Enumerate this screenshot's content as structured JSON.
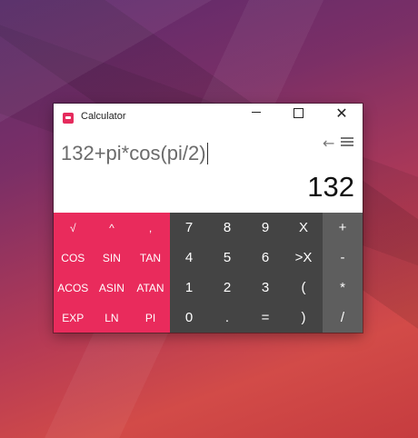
{
  "window": {
    "title": "Calculator"
  },
  "window_controls": {
    "minimize": "",
    "maximize": "",
    "close": "✕"
  },
  "display": {
    "expression": "132+pi*cos(pi/2)",
    "result": "132"
  },
  "function_keys": [
    [
      "√",
      "^",
      ","
    ],
    [
      "COS",
      "SIN",
      "TAN"
    ],
    [
      "ACOS",
      "ASIN",
      "ATAN"
    ],
    [
      "EXP",
      "LN",
      "PI"
    ]
  ],
  "number_keys": [
    [
      "7",
      "8",
      "9",
      "X"
    ],
    [
      "4",
      "5",
      "6",
      ">X"
    ],
    [
      "1",
      "2",
      "3",
      "("
    ],
    [
      "0",
      ".",
      "=",
      ")"
    ]
  ],
  "operator_keys": [
    "+",
    "-",
    "*",
    "/"
  ],
  "icons": {
    "back": "←"
  },
  "colors": {
    "function_panel": "#e92b5c",
    "number_panel": "#444444",
    "operator_panel": "#5e5e5e"
  }
}
